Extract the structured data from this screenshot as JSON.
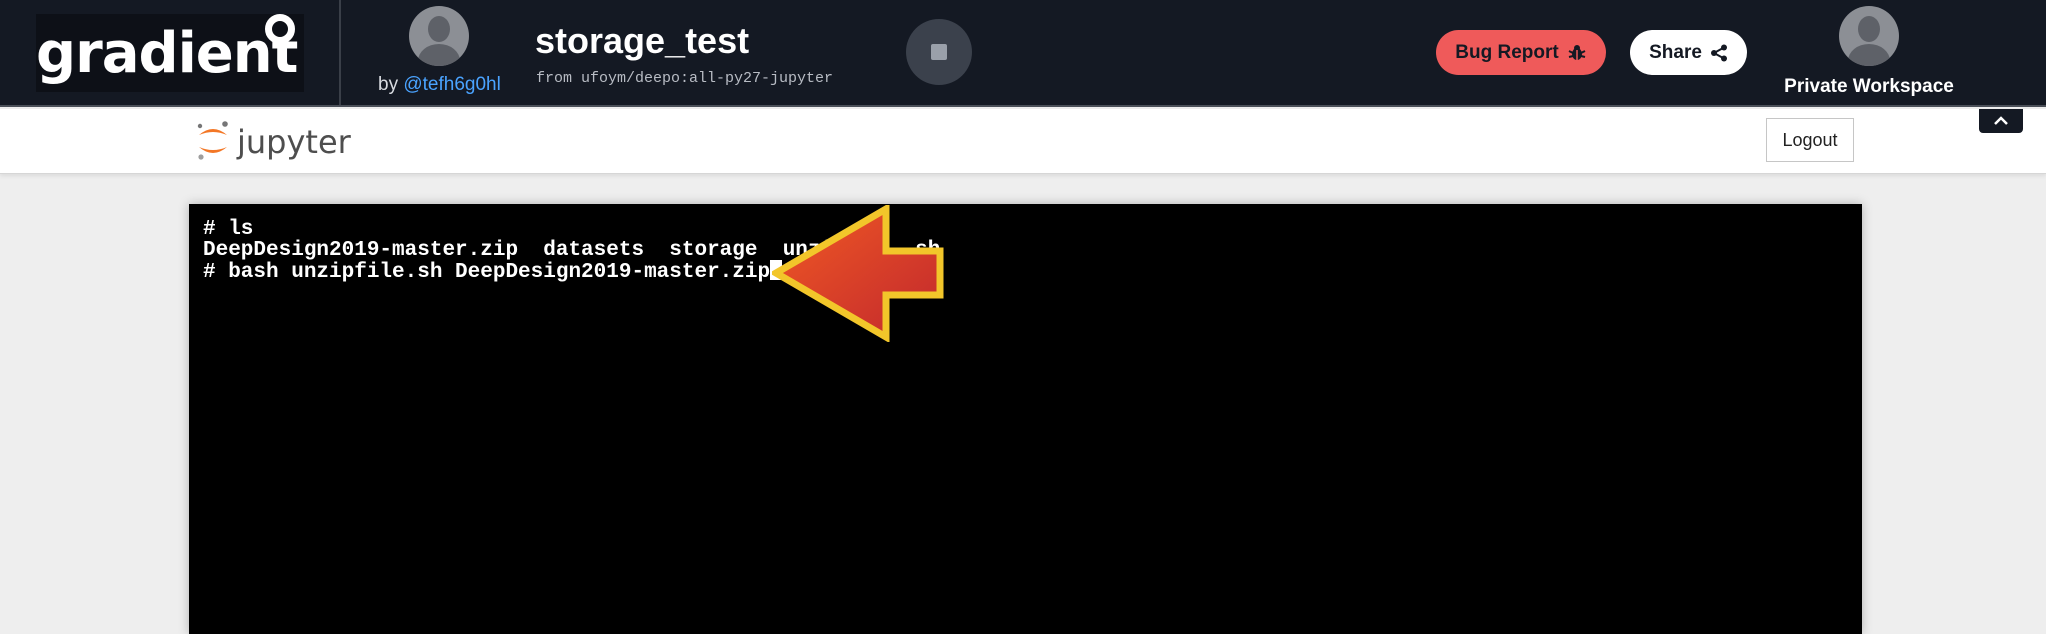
{
  "topbar": {
    "logo_text": "gradient",
    "owner_prefix": "by",
    "owner_handle": "@tefh6g0hl",
    "notebook_title": "storage_test",
    "container_source": "from ufoym/deepo:all-py27-jupyter",
    "bug_report_label": "Bug Report",
    "share_label": "Share",
    "workspace_label": "Private Workspace"
  },
  "jupyter": {
    "logo_text": "jupyter",
    "logout_label": "Logout"
  },
  "terminal": {
    "lines": [
      "# ls",
      "DeepDesign2019-master.zip  datasets  storage  unzi",
      "# bash unzipfile.sh DeepDesign2019-master.zip"
    ],
    "hidden_tail": "sh"
  },
  "colors": {
    "topbar_bg": "#141923",
    "bug_button": "#ef5a5a",
    "link": "#4aa3ff",
    "arrow_fill": "#e23b1e",
    "arrow_outline": "#f2c62a"
  },
  "icons": {
    "bug": "bug-icon",
    "share": "share-icon",
    "stop": "stop-icon",
    "collapse": "chevron-up-icon"
  }
}
